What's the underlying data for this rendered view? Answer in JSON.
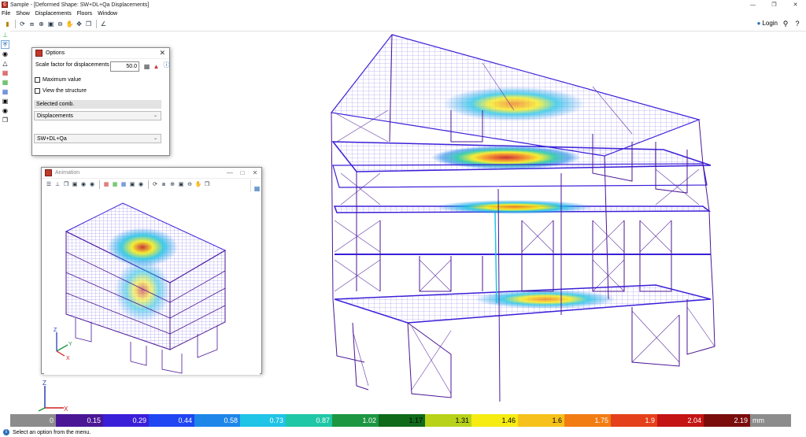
{
  "app": {
    "title": "Sample - [Deformed Shape: SW+DL+Qa Displacements]"
  },
  "menu": [
    "File",
    "Show",
    "Displacements",
    "Floors",
    "Window"
  ],
  "login_label": "Login",
  "options": {
    "title": "Options",
    "scale_label": "Scale factor for displacements",
    "scale_value": "50.0",
    "max_value_label": "Maximum value",
    "view_structure_label": "View the structure",
    "selected_comb_label": "Selected comb.",
    "displacements_option": "Displacements",
    "combination_option": "SW+DL+Qa"
  },
  "animation": {
    "title": "Animation"
  },
  "axes": {
    "z": "Z",
    "y": "Y",
    "x": "X"
  },
  "legend": {
    "labels": [
      "0",
      "0.15",
      "0.29",
      "0.44",
      "0.58",
      "0.73",
      "0.87",
      "1.02",
      "1.17",
      "1.31",
      "1.46",
      "1.6",
      "1.75",
      "1.9",
      "2.04",
      "2.19"
    ],
    "unit": "mm",
    "colors": [
      "#8c8c8c",
      "#4b1696",
      "#3a1fd8",
      "#1f46f2",
      "#1e86e8",
      "#1fc4e6",
      "#1fc7a6",
      "#1d9642",
      "#0f6a1a",
      "#b8d21a",
      "#f6ec12",
      "#f5c11a",
      "#f27c12",
      "#e5401c",
      "#c41414",
      "#7a0c0c",
      "#8c8c8c"
    ]
  },
  "status": {
    "message": "Select an option from the menu."
  }
}
